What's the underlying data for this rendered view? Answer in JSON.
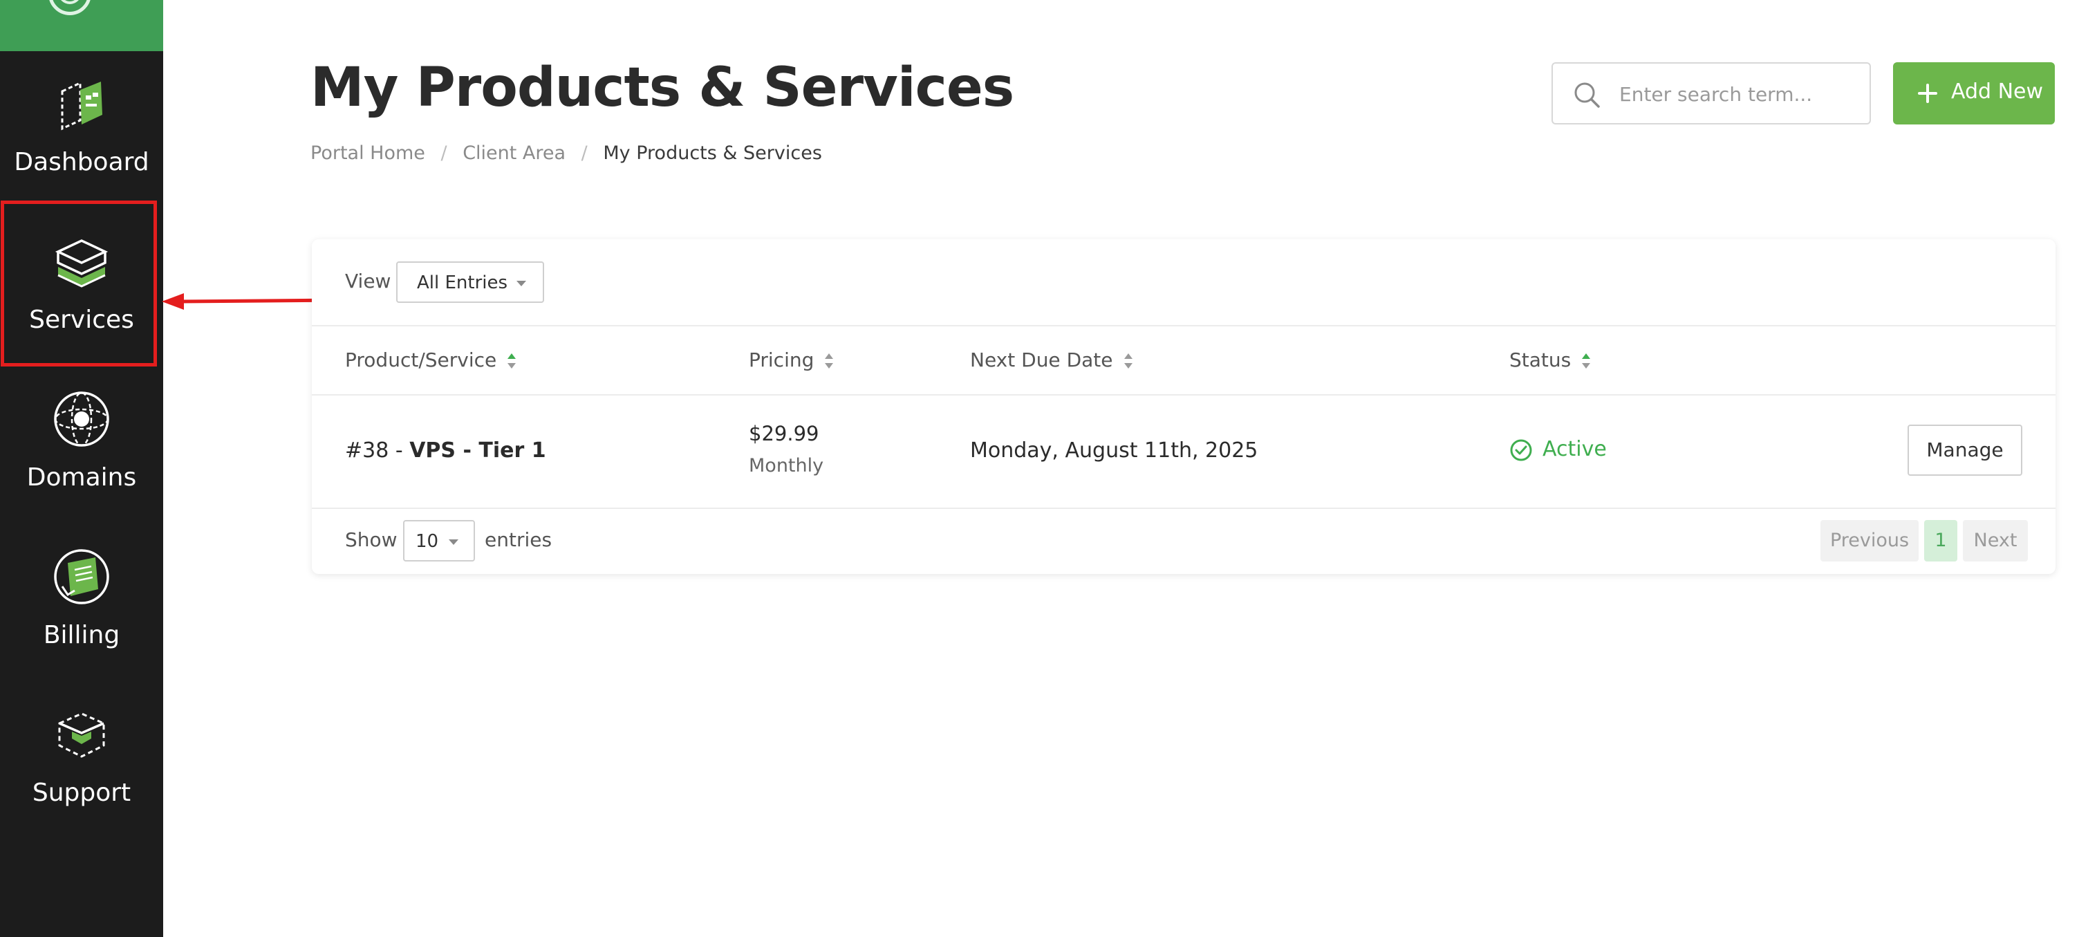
{
  "sidebar": {
    "items": [
      {
        "label": "Dashboard",
        "icon": "dashboard-icon"
      },
      {
        "label": "Services",
        "icon": "services-icon"
      },
      {
        "label": "Domains",
        "icon": "domains-icon"
      },
      {
        "label": "Billing",
        "icon": "billing-icon"
      },
      {
        "label": "Support",
        "icon": "support-icon"
      }
    ],
    "active": "Services"
  },
  "header": {
    "title": "My Products & Services",
    "breadcrumb": [
      "Portal Home",
      "Client Area",
      "My Products & Services"
    ],
    "breadcrumb_separator": "/",
    "search_placeholder": "Enter search term...",
    "add_new_label": "Add New"
  },
  "table": {
    "view_label": "View",
    "view_selected": "All Entries",
    "columns": [
      "Product/Service",
      "Pricing",
      "Next Due Date",
      "Status"
    ],
    "rows": [
      {
        "product_id": "#38 - ",
        "product_name": "VPS - Tier 1",
        "price": "$29.99",
        "billing_cycle": "Monthly",
        "next_due_date": "Monday, August 11th, 2025",
        "status": "Active",
        "action": "Manage"
      }
    ],
    "show_label": "Show",
    "page_length": "10",
    "entries_label": "entries",
    "pagination": {
      "previous": "Previous",
      "current": "1",
      "next": "Next"
    }
  },
  "colors": {
    "sidebar_bg": "#1c1c1c",
    "logo_green": "#3f9e55",
    "accent_green": "#6cb64b",
    "status_active": "#3fae4f",
    "annotation_red": "#e41e1e"
  }
}
